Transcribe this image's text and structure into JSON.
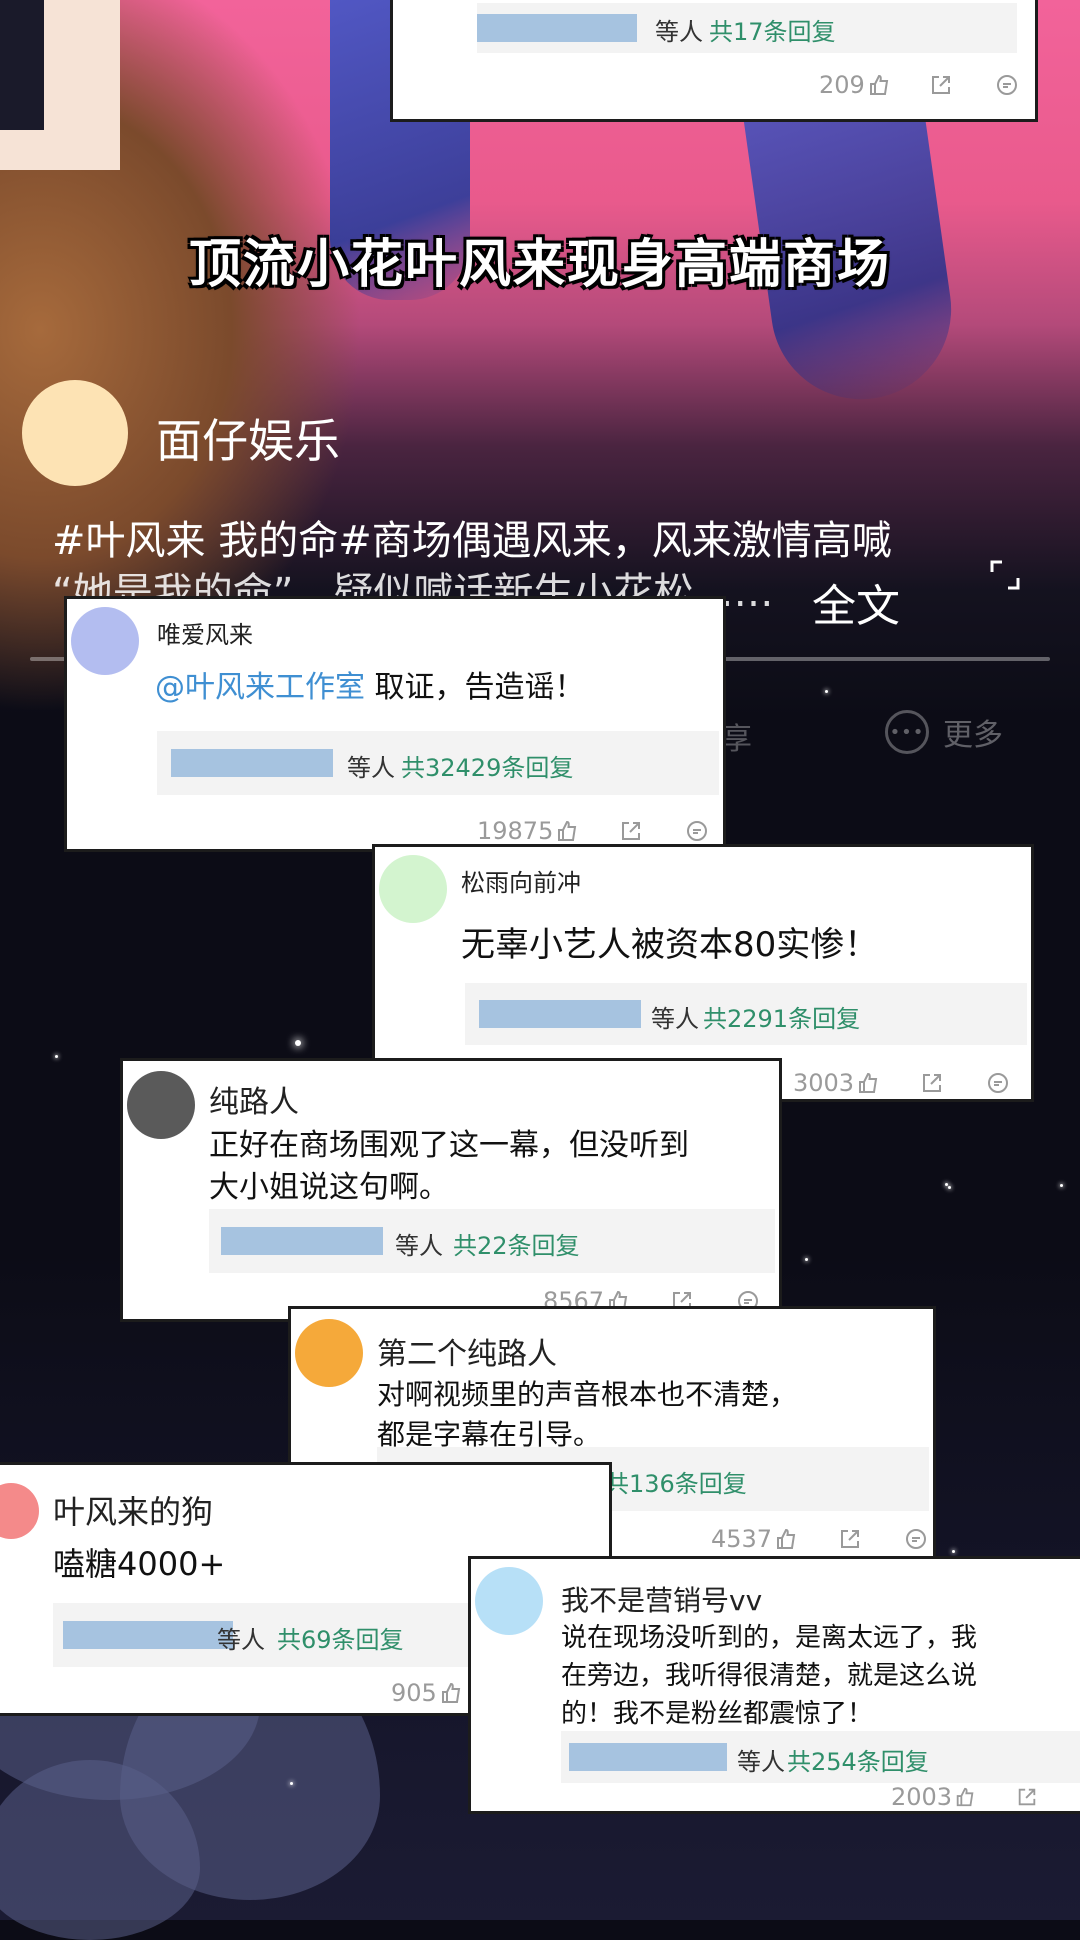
{
  "headline": "顶流小花叶风来现身高端商场",
  "post": {
    "author": "面仔娱乐",
    "text_line1": "#叶风来 我的命#商场偶遇风来，风来激情高喊",
    "text_line2": "“她是我的命”，疑似喊话新生小花松",
    "ellipsis": "……",
    "full_text_link": "全文"
  },
  "toolbar": {
    "more_label": "更多",
    "side_label": "享"
  },
  "comments": [
    {
      "user": "",
      "text": "",
      "reply_who": "等人",
      "reply_count": "共17条回复",
      "likes": "209"
    },
    {
      "user": "唯爱风来",
      "mention": "@叶风来工作室",
      "text": " 取证，告造谣！",
      "reply_who": "等人",
      "reply_count": "共32429条回复",
      "likes": "19875",
      "avatar_color": "#b3bdf0"
    },
    {
      "user": "松雨向前冲",
      "text": "无辜小艺人被资本80实惨！",
      "reply_who": "等人",
      "reply_count": "共2291条回复",
      "likes": "3003",
      "avatar_color": "#d3f4cf"
    },
    {
      "user": "纯路人",
      "text_line1": "正好在商场围观了这一幕，但没听到",
      "text_line2": "大小姐说这句啊。",
      "reply_who": "等人",
      "reply_count": "共22条回复",
      "likes": "8567",
      "avatar_color": "#5a5a5a"
    },
    {
      "user": "第二个纯路人",
      "text_line1": "对啊视频里的声音根本也不清楚，",
      "text_line2": "都是字幕在引导。",
      "reply_count": "共136条回复",
      "likes": "4537",
      "avatar_color": "#f5a93a"
    },
    {
      "user": "叶风来的狗",
      "text": "嗑糖4000+",
      "reply_who": "等人",
      "reply_count": "共69条回复",
      "likes": "905",
      "avatar_color": "#f48a8a"
    },
    {
      "user": "我不是营销号vv",
      "text_line1": "说在现场没听到的，是离太远了，我",
      "text_line2": "在旁边，我听得很清楚，就是这么说",
      "text_line3": "的！我不是粉丝都震惊了！",
      "reply_who": "等人",
      "reply_count": "共254条回复",
      "likes": "2003",
      "avatar_color": "#b7e0f7"
    }
  ],
  "colors": {
    "reply_count": "#2f8f6a",
    "mention": "#3f8fd2",
    "card_border": "#1c1c1c"
  }
}
